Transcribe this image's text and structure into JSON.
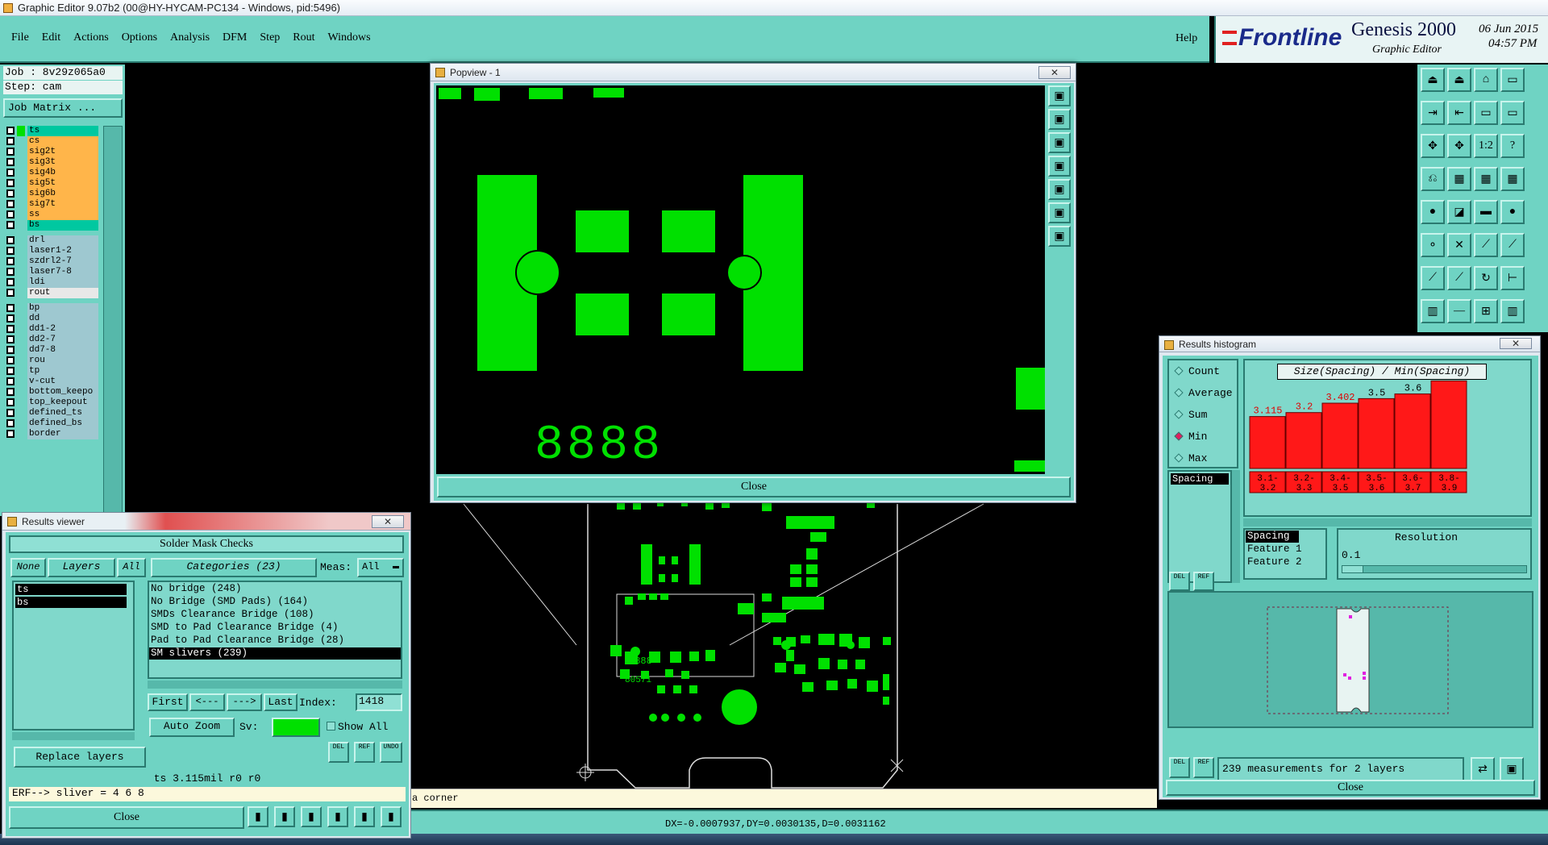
{
  "app_title": "Graphic Editor 9.07b2 (00@HY-HYCAM-PC134 - Windows, pid:5496)",
  "menu": [
    "File",
    "Edit",
    "Actions",
    "Options",
    "Analysis",
    "DFM",
    "Step",
    "Rout",
    "Windows"
  ],
  "help_label": "Help",
  "brand": {
    "logo": "Frontline",
    "product": "Genesis 2000",
    "subtitle": "Graphic Editor",
    "date": "06 Jun 2015",
    "time": "04:57 PM"
  },
  "job": {
    "job_label": "Job : 8v29z065a0",
    "step_label": "Step: cam",
    "matrix_button": "Job Matrix ..."
  },
  "layers": [
    {
      "name": "ts",
      "color": "#00c8a0"
    },
    {
      "name": "cs",
      "color": "#ffb54a"
    },
    {
      "name": "sig2t",
      "color": "#ffb54a"
    },
    {
      "name": "sig3t",
      "color": "#ffb54a"
    },
    {
      "name": "sig4b",
      "color": "#ffb54a"
    },
    {
      "name": "sig5t",
      "color": "#ffb54a"
    },
    {
      "name": "sig6b",
      "color": "#ffb54a"
    },
    {
      "name": "sig7t",
      "color": "#ffb54a"
    },
    {
      "name": "ss",
      "color": "#ffb54a"
    },
    {
      "name": "bs",
      "color": "#00c8a0"
    },
    {
      "name": "drl",
      "color": "#9ec8d0"
    },
    {
      "name": "laser1-2",
      "color": "#9ec8d0"
    },
    {
      "name": "szdrl2-7",
      "color": "#9ec8d0"
    },
    {
      "name": "laser7-8",
      "color": "#9ec8d0"
    },
    {
      "name": "ldi",
      "color": "#9ec8d0"
    },
    {
      "name": "rout",
      "color": "#e8e8e8"
    },
    {
      "name": "bp",
      "color": "#9ec8d0"
    },
    {
      "name": "dd",
      "color": "#9ec8d0"
    },
    {
      "name": "dd1-2",
      "color": "#9ec8d0"
    },
    {
      "name": "dd2-7",
      "color": "#9ec8d0"
    },
    {
      "name": "dd7-8",
      "color": "#9ec8d0"
    },
    {
      "name": "rou",
      "color": "#9ec8d0"
    },
    {
      "name": "tp",
      "color": "#9ec8d0"
    },
    {
      "name": "v-cut",
      "color": "#9ec8d0"
    },
    {
      "name": "bottom_keepo",
      "color": "#9ec8d0"
    },
    {
      "name": "top_keepout",
      "color": "#9ec8d0"
    },
    {
      "name": "defined_ts",
      "color": "#9ec8d0"
    },
    {
      "name": "defined_bs",
      "color": "#9ec8d0"
    },
    {
      "name": "border",
      "color": "#9ec8d0"
    }
  ],
  "popview": {
    "title": "Popview - 1",
    "close": "Close",
    "digits": "8888"
  },
  "results_viewer": {
    "title": "Results viewer",
    "header": "Solder Mask Checks",
    "none_btn": "None",
    "layers_btn": "Layers",
    "all_btn": "All",
    "categories": "Categories (23)",
    "meas_label": "Meas:",
    "meas_value": "All",
    "layer_list": [
      "ts",
      "bs"
    ],
    "category_list": [
      "No bridge (248)",
      "No Bridge (SMD Pads) (164)",
      "SMDs Clearance Bridge (108)",
      "SMD to Pad Clearance Bridge (4)",
      "Pad to Pad Clearance Bridge (28)",
      "SM slivers (239)"
    ],
    "first": "First",
    "prev": "<---",
    "next": "--->",
    "last": "Last",
    "index_label": "Index:",
    "index_value": "1418",
    "auto_zoom": "Auto Zoom",
    "sv_label": "Sv:",
    "show_all": "Show All",
    "replace_layers": "Replace layers",
    "del": "DEL",
    "ref": "REF",
    "undo": "UNDO",
    "status": "ts 3.115mil  r0  r0",
    "erf": "ERF--> sliver = 4 6 8",
    "close": "Close"
  },
  "histogram": {
    "title": "Results histogram",
    "options": [
      "Count",
      "Average",
      "Sum",
      "Min",
      "Max"
    ],
    "selected": "Min",
    "list_item": "Spacing",
    "chart_title": "Size(Spacing) / Min(Spacing)",
    "bars": [
      {
        "range": "3.1-\n3.2",
        "value": "3.115",
        "v": 3.115
      },
      {
        "range": "3.2-\n3.3",
        "value": "3.2",
        "v": 3.2
      },
      {
        "range": "3.4-\n3.5",
        "value": "3.402",
        "v": 3.402
      },
      {
        "range": "3.5-\n3.6",
        "value": "3.5",
        "v": 3.5
      },
      {
        "range": "3.6-\n3.7",
        "value": "3.6",
        "v": 3.6
      },
      {
        "range": "3.8-\n3.9",
        "value": "3.881",
        "v": 3.881
      }
    ],
    "axis_list": [
      "Spacing",
      "Feature 1",
      "Feature 2"
    ],
    "resolution_label": "Resolution",
    "resolution_value": "0.1",
    "del": "DEL",
    "ref": "REF",
    "measurements": "239 measurements for 2 layers",
    "close": "Close"
  },
  "coords": "DX=-0.0007937,DY=0.0030135,D=0.0031162",
  "prompt_text": "a corner",
  "pcb_text": [
    "8888",
    "80571"
  ]
}
